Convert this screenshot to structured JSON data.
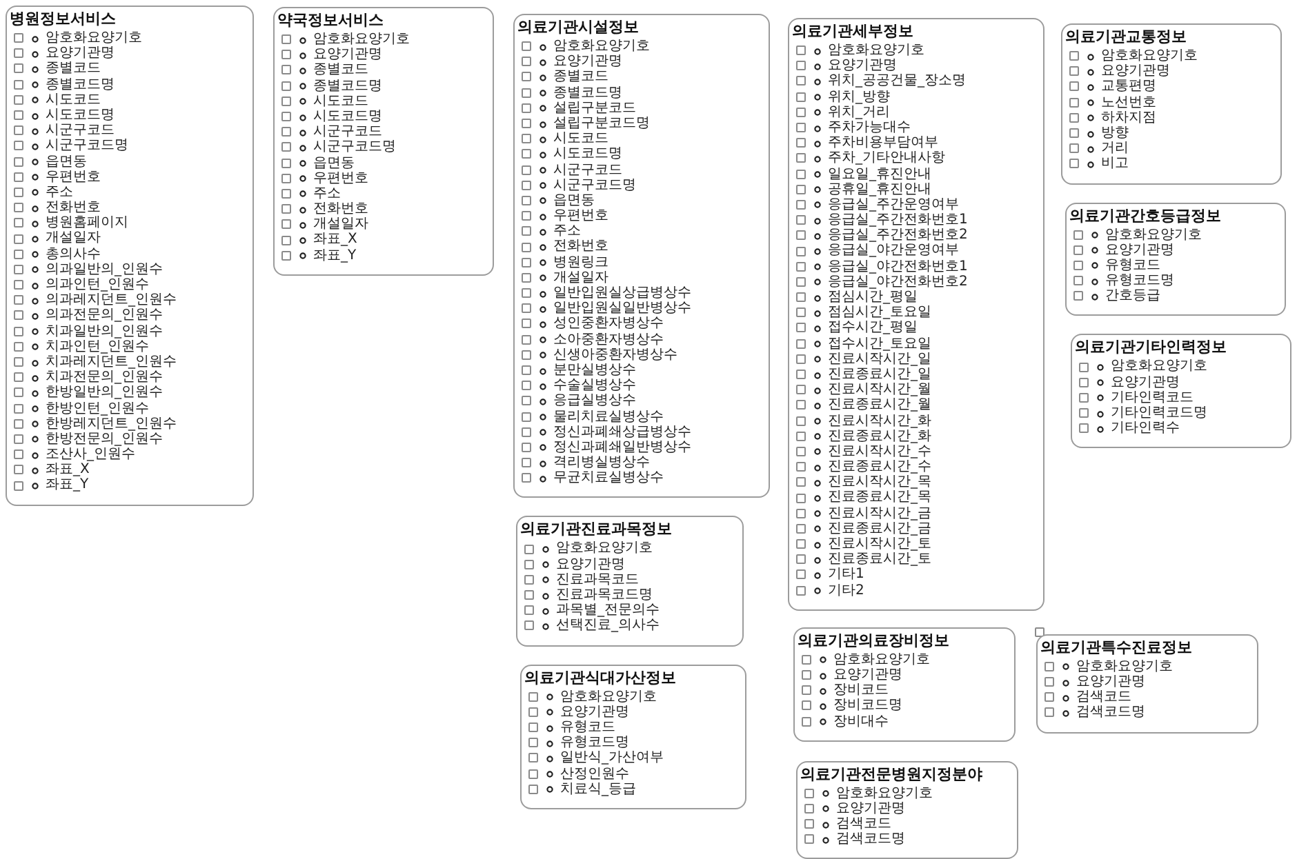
{
  "groups": [
    {
      "title": "병원정보서비스",
      "fields": [
        {
          "label": "암호화요양기호",
          "checked": false
        },
        {
          "label": "요양기관명",
          "checked": false
        },
        {
          "label": "종별코드",
          "checked": false
        },
        {
          "label": "종별코드명",
          "checked": false
        },
        {
          "label": "시도코드",
          "checked": false
        },
        {
          "label": "시도코드명",
          "checked": false
        },
        {
          "label": "시군구코드",
          "checked": false
        },
        {
          "label": "시군구코드명",
          "checked": false
        },
        {
          "label": "읍면동",
          "checked": false
        },
        {
          "label": "우편번호",
          "checked": false
        },
        {
          "label": "주소",
          "checked": false
        },
        {
          "label": "전화번호",
          "checked": false
        },
        {
          "label": "병원홈페이지",
          "checked": false
        },
        {
          "label": "개설일자",
          "checked": false
        },
        {
          "label": "총의사수",
          "checked": false
        },
        {
          "label": "의과일반의_인원수",
          "checked": false
        },
        {
          "label": "의과인턴_인원수",
          "checked": false
        },
        {
          "label": "의과레지던트_인원수",
          "checked": false
        },
        {
          "label": "의과전문의_인원수",
          "checked": false
        },
        {
          "label": "치과일반의_인원수",
          "checked": false
        },
        {
          "label": "치과인턴_인원수",
          "checked": false
        },
        {
          "label": "치과레지던트_인원수",
          "checked": false
        },
        {
          "label": "치과전문의_인원수",
          "checked": false
        },
        {
          "label": "한방일반의_인원수",
          "checked": false
        },
        {
          "label": "한방인턴_인원수",
          "checked": false
        },
        {
          "label": "한방레지던트_인원수",
          "checked": false
        },
        {
          "label": "한방전문의_인원수",
          "checked": false
        },
        {
          "label": "조산사_인원수",
          "checked": false
        },
        {
          "label": "좌표_X",
          "checked": false
        },
        {
          "label": "좌표_Y",
          "checked": false
        }
      ]
    },
    {
      "title": "약국정보서비스",
      "fields": [
        {
          "label": "암호화요양기호",
          "checked": false
        },
        {
          "label": "요양기관명",
          "checked": false
        },
        {
          "label": "종별코드",
          "checked": false
        },
        {
          "label": "종별코드명",
          "checked": false
        },
        {
          "label": "시도코드",
          "checked": false
        },
        {
          "label": "시도코드명",
          "checked": false
        },
        {
          "label": "시군구코드",
          "checked": false
        },
        {
          "label": "시군구코드명",
          "checked": false
        },
        {
          "label": "읍면동",
          "checked": false
        },
        {
          "label": "우편번호",
          "checked": false
        },
        {
          "label": "주소",
          "checked": false
        },
        {
          "label": "전화번호",
          "checked": false
        },
        {
          "label": "개설일자",
          "checked": false
        },
        {
          "label": "좌표_X",
          "checked": false
        },
        {
          "label": "좌표_Y",
          "checked": false
        }
      ]
    },
    {
      "title": "의료기관시설정보",
      "fields": [
        {
          "label": "암호화요양기호",
          "checked": false
        },
        {
          "label": "요양기관명",
          "checked": false
        },
        {
          "label": "종별코드",
          "checked": false
        },
        {
          "label": "종별코드명",
          "checked": false
        },
        {
          "label": "설립구분코드",
          "checked": false
        },
        {
          "label": "설립구분코드명",
          "checked": false
        },
        {
          "label": "시도코드",
          "checked": false
        },
        {
          "label": "시도코드명",
          "checked": false
        },
        {
          "label": "시군구코드",
          "checked": false
        },
        {
          "label": "시군구코드명",
          "checked": false
        },
        {
          "label": "읍면동",
          "checked": false
        },
        {
          "label": "우편번호",
          "checked": false
        },
        {
          "label": "주소",
          "checked": false
        },
        {
          "label": "전화번호",
          "checked": false
        },
        {
          "label": "병원링크",
          "checked": false
        },
        {
          "label": "개설일자",
          "checked": false
        },
        {
          "label": "일반입원실상급병상수",
          "checked": false
        },
        {
          "label": "일반입원실일반병상수",
          "checked": false
        },
        {
          "label": "성인중환자병상수",
          "checked": false
        },
        {
          "label": "소아중환자병상수",
          "checked": false
        },
        {
          "label": "신생아중환자병상수",
          "checked": false
        },
        {
          "label": "분만실병상수",
          "checked": false
        },
        {
          "label": "수술실병상수",
          "checked": false
        },
        {
          "label": "응급실병상수",
          "checked": false
        },
        {
          "label": "물리치료실병상수",
          "checked": false
        },
        {
          "label": "정신과폐쇄상급병상수",
          "checked": false
        },
        {
          "label": "정신과폐쇄일반병상수",
          "checked": false
        },
        {
          "label": "격리병실병상수",
          "checked": false
        },
        {
          "label": "무균치료실병상수",
          "checked": false
        }
      ]
    },
    {
      "title": "의료기관세부정보",
      "fields": [
        {
          "label": "암호화요양기호",
          "checked": false
        },
        {
          "label": "요양기관명",
          "checked": false
        },
        {
          "label": "위치_공공건물_장소명",
          "checked": false
        },
        {
          "label": "위치_방향",
          "checked": false
        },
        {
          "label": "위치_거리",
          "checked": false
        },
        {
          "label": "주차가능대수",
          "checked": false
        },
        {
          "label": "주차비용부담여부",
          "checked": false
        },
        {
          "label": "주차_기타안내사항",
          "checked": false
        },
        {
          "label": "일요일_휴진안내",
          "checked": false
        },
        {
          "label": "공휴일_휴진안내",
          "checked": false
        },
        {
          "label": "응급실_주간운영여부",
          "checked": false
        },
        {
          "label": "응급실_주간전화번호1",
          "checked": false
        },
        {
          "label": "응급실_주간전화번호2",
          "checked": false
        },
        {
          "label": "응급실_야간운영여부",
          "checked": false
        },
        {
          "label": "응급실_야간전화번호1",
          "checked": false
        },
        {
          "label": "응급실_야간전화번호2",
          "checked": false
        },
        {
          "label": "점심시간_평일",
          "checked": false
        },
        {
          "label": "점심시간_토요일",
          "checked": false
        },
        {
          "label": "접수시간_평일",
          "checked": false
        },
        {
          "label": "접수시간_토요일",
          "checked": false
        },
        {
          "label": "진료시작시간_일",
          "checked": false
        },
        {
          "label": "진료종료시간_일",
          "checked": false
        },
        {
          "label": "진료시작시간_월",
          "checked": false
        },
        {
          "label": "진료종료시간_월",
          "checked": false
        },
        {
          "label": "진료시작시간_화",
          "checked": false
        },
        {
          "label": "진료종료시간_화",
          "checked": false
        },
        {
          "label": "진료시작시간_수",
          "checked": false
        },
        {
          "label": "진료종료시간_수",
          "checked": false
        },
        {
          "label": "진료시작시간_목",
          "checked": false
        },
        {
          "label": "진료종료시간_목",
          "checked": false
        },
        {
          "label": "진료시작시간_금",
          "checked": false
        },
        {
          "label": "진료종료시간_금",
          "checked": false
        },
        {
          "label": "진료시작시간_토",
          "checked": false
        },
        {
          "label": "진료종료시간_토",
          "checked": false
        },
        {
          "label": "기타1",
          "checked": false
        },
        {
          "label": "기타2",
          "checked": false
        }
      ]
    },
    {
      "title": "의료기관교통정보",
      "fields": [
        {
          "label": "암호화요양기호",
          "checked": false
        },
        {
          "label": "요양기관명",
          "checked": false
        },
        {
          "label": "교통편명",
          "checked": false
        },
        {
          "label": "노선번호",
          "checked": false
        },
        {
          "label": "하차지점",
          "checked": false
        },
        {
          "label": "방향",
          "checked": false
        },
        {
          "label": "거리",
          "checked": false
        },
        {
          "label": "비고",
          "checked": false
        }
      ]
    },
    {
      "title": "의료기관간호등급정보",
      "fields": [
        {
          "label": "암호화요양기호",
          "checked": false
        },
        {
          "label": "요양기관명",
          "checked": false
        },
        {
          "label": "유형코드",
          "checked": false
        },
        {
          "label": "유형코드명",
          "checked": false
        },
        {
          "label": "간호등급",
          "checked": false
        }
      ]
    },
    {
      "title": "의료기관기타인력정보",
      "fields": [
        {
          "label": "암호화요양기호",
          "checked": false
        },
        {
          "label": "요양기관명",
          "checked": false
        },
        {
          "label": "기타인력코드",
          "checked": false
        },
        {
          "label": "기타인력코드명",
          "checked": false
        },
        {
          "label": "기타인력수",
          "checked": false
        }
      ]
    },
    {
      "title": "의료기관진료과목정보",
      "fields": [
        {
          "label": "암호화요양기호",
          "checked": false
        },
        {
          "label": "요양기관명",
          "checked": false
        },
        {
          "label": "진료과목코드",
          "checked": false
        },
        {
          "label": "진료과목코드명",
          "checked": false
        },
        {
          "label": "과목별_전문의수",
          "checked": false
        },
        {
          "label": "선택진료_의사수",
          "checked": false
        }
      ]
    },
    {
      "title": "의료기관식대가산정보",
      "fields": [
        {
          "label": "암호화요양기호",
          "checked": false
        },
        {
          "label": "요양기관명",
          "checked": false
        },
        {
          "label": "유형코드",
          "checked": false
        },
        {
          "label": "유형코드명",
          "checked": false
        },
        {
          "label": "일반식_가산여부",
          "checked": false
        },
        {
          "label": "산정인원수",
          "checked": false
        },
        {
          "label": "치료식_등급",
          "checked": false
        }
      ]
    },
    {
      "title": "의료기관의료장비정보",
      "fields": [
        {
          "label": "암호화요양기호",
          "checked": false
        },
        {
          "label": "요양기관명",
          "checked": false
        },
        {
          "label": "장비코드",
          "checked": false
        },
        {
          "label": "장비코드명",
          "checked": false
        },
        {
          "label": "장비대수",
          "checked": false
        }
      ]
    },
    {
      "title": "의료기관특수진료정보",
      "fields": [
        {
          "label": "암호화요양기호",
          "checked": false
        },
        {
          "label": "요양기관명",
          "checked": false
        },
        {
          "label": "검색코드",
          "checked": false
        },
        {
          "label": "검색코드명",
          "checked": false
        }
      ]
    },
    {
      "title": "의료기관전문병원지정분야",
      "fields": [
        {
          "label": "암호화요양기호",
          "checked": false
        },
        {
          "label": "요양기관명",
          "checked": false
        },
        {
          "label": "검색코드",
          "checked": false
        },
        {
          "label": "검색코드명",
          "checked": false
        }
      ]
    }
  ]
}
